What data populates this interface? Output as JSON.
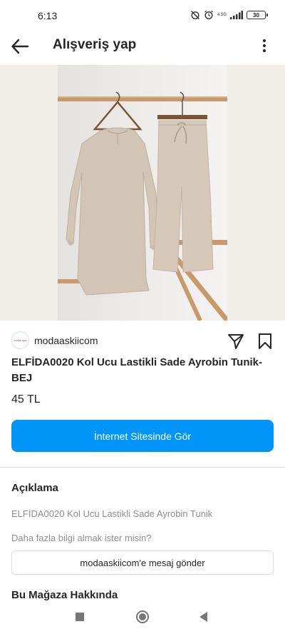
{
  "status_bar": {
    "time": "6:13",
    "network": "4.5G",
    "battery": "30"
  },
  "app_bar": {
    "title": "Alışveriş yap"
  },
  "product": {
    "shop_name": "modaaskiicom",
    "shop_logo_text": "moda aşkı",
    "title": "ELFİDA0020 Kol Ucu Lastikli Sade Ayrobin Tunik-BEJ",
    "price": "45 TL",
    "primary_button_label": "İnternet Sitesinde Gör"
  },
  "description": {
    "section_title": "Açıklama",
    "text": "ELFİDA0020 Kol Ucu Lastikli Sade Ayrobin Tunik",
    "question": "Daha fazla bilgi almak ister misin?",
    "message_button_label": "modaaskiicom'e mesaj gönder"
  },
  "about": {
    "section_title": "Bu Mağaza Hakkında"
  },
  "icons": {
    "back": "arrow-left-icon",
    "more": "more-vertical-icon",
    "share": "send-icon",
    "save": "bookmark-icon"
  },
  "colors": {
    "accent": "#0095f6",
    "product_color": "#cdbfae"
  }
}
